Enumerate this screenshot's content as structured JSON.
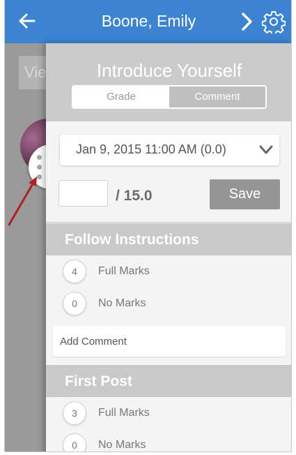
{
  "header": {
    "title": "Boone, Emily",
    "back_icon": "arrow-left-icon",
    "next_icon": "chevron-right-icon",
    "settings_icon": "gear-icon",
    "background_color": "#3c83d0"
  },
  "background": {
    "view_button_label": "Vie"
  },
  "drawer": {
    "assignment_title": "Introduce Yourself",
    "tabs": [
      {
        "label": "Grade",
        "active": false
      },
      {
        "label": "Comment",
        "active": true
      }
    ],
    "submission": {
      "selected": "Jan 9, 2015 11:00 AM (0.0)"
    },
    "score": {
      "value": "",
      "total": "/ 15.0"
    },
    "save_label": "Save",
    "criteria": [
      {
        "name": "Follow Instructions",
        "ratings": [
          {
            "points": "4",
            "label": "Full Marks"
          },
          {
            "points": "0",
            "label": "No Marks"
          }
        ],
        "comment_placeholder": "Add Comment"
      },
      {
        "name": "First Post",
        "ratings": [
          {
            "points": "3",
            "label": "Full Marks"
          },
          {
            "points": "0",
            "label": "No Marks"
          }
        ]
      }
    ]
  },
  "colors": {
    "accent": "#3c83d0",
    "annotation_arrow": "#b01f24",
    "save_button": "#959595"
  }
}
